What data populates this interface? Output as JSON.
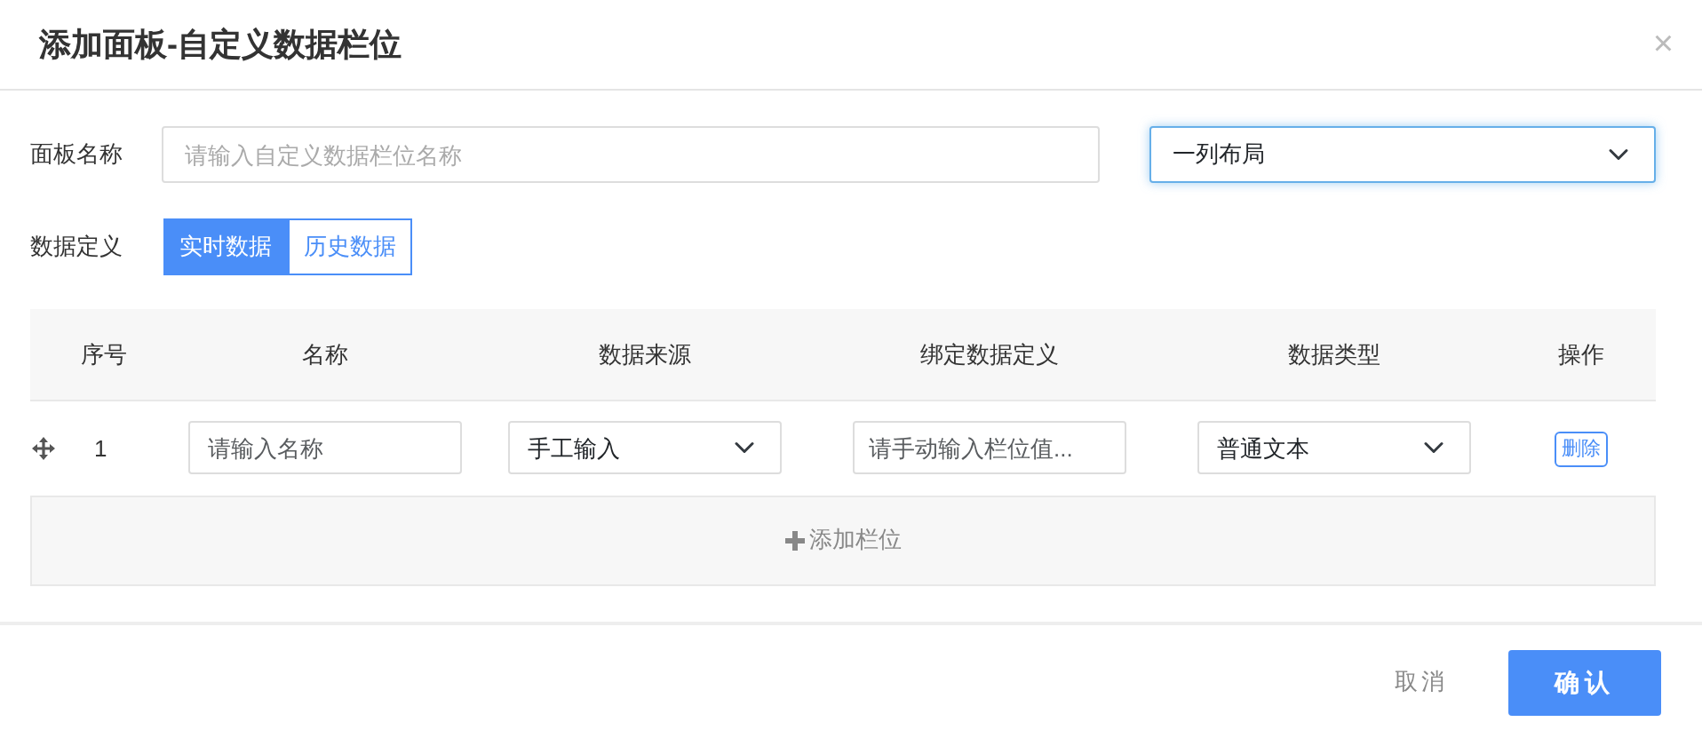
{
  "dialog": {
    "title": "添加面板-自定义数据栏位",
    "close": "×"
  },
  "panel_name": {
    "label": "面板名称",
    "placeholder": "请输入自定义数据栏位名称"
  },
  "layout_select": {
    "value": "一列布局",
    "focused": true
  },
  "data_definition": {
    "label": "数据定义",
    "tabs": [
      {
        "label": "实时数据",
        "selected": true
      },
      {
        "label": "历史数据",
        "selected": false
      }
    ]
  },
  "table": {
    "columns": [
      "序号",
      "名称",
      "数据来源",
      "绑定数据定义",
      "数据类型",
      "操作"
    ],
    "rows": [
      {
        "index": "1",
        "name_placeholder": "请输入名称",
        "source": "手工输入",
        "binding_placeholder": "请手动输入栏位值...",
        "type": "普通文本",
        "action": "删除"
      }
    ],
    "add_button": "添加栏位"
  },
  "footer": {
    "cancel": "取消",
    "confirm": "确认"
  }
}
